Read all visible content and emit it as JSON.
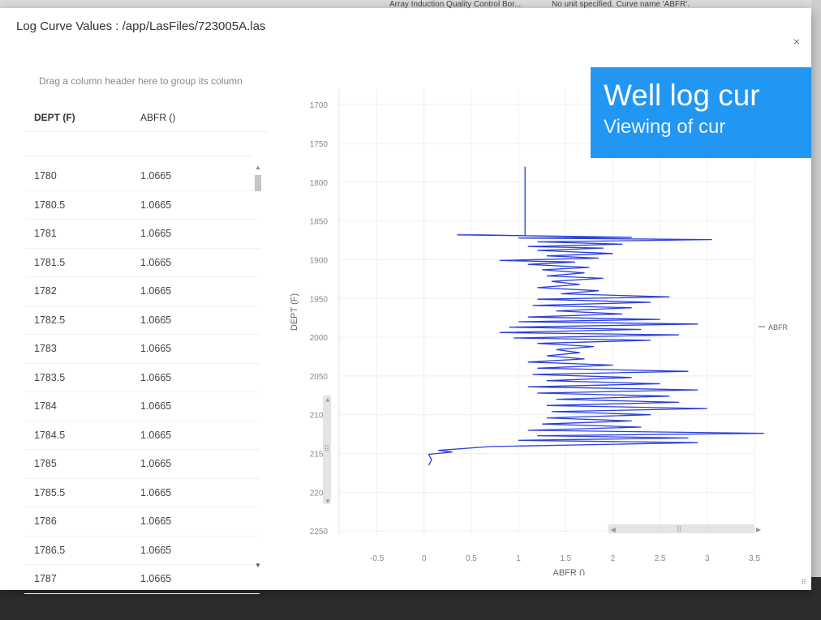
{
  "background": {
    "col_a": "Array Induction Quality Control Bor...",
    "col_b": "No unit specified. Curve name 'ABFR'."
  },
  "modal": {
    "title": "Log Curve Values : /app/LasFiles/723005A.las",
    "close": "×"
  },
  "grid": {
    "group_hint": "Drag a column header here to group its column",
    "columns": [
      "DEPT (F)",
      "ABFR ()"
    ],
    "rows": [
      [
        "1780",
        "1.0665"
      ],
      [
        "1780.5",
        "1.0665"
      ],
      [
        "1781",
        "1.0665"
      ],
      [
        "1781.5",
        "1.0665"
      ],
      [
        "1782",
        "1.0665"
      ],
      [
        "1782.5",
        "1.0665"
      ],
      [
        "1783",
        "1.0665"
      ],
      [
        "1783.5",
        "1.0665"
      ],
      [
        "1784",
        "1.0665"
      ],
      [
        "1784.5",
        "1.0665"
      ],
      [
        "1785",
        "1.0665"
      ],
      [
        "1785.5",
        "1.0665"
      ],
      [
        "1786",
        "1.0665"
      ],
      [
        "1786.5",
        "1.0665"
      ],
      [
        "1787",
        "1.0665"
      ]
    ]
  },
  "banner": {
    "title": "Well log cur",
    "subtitle": "Viewing of cur"
  },
  "chart_data": {
    "type": "line",
    "xlabel": "ABFR ()",
    "ylabel": "DEPT (F)",
    "xlim": [
      -0.9,
      3.5
    ],
    "ylim": [
      1680,
      2255
    ],
    "y_reversed": true,
    "xticks": [
      -0.5,
      0,
      0.5,
      1,
      1.5,
      2,
      2.5,
      3,
      3.5
    ],
    "yticks": [
      1700,
      1750,
      1800,
      1850,
      1900,
      1950,
      2000,
      2050,
      2100,
      2150,
      2200,
      2250
    ],
    "grid": true,
    "legend": "right",
    "series_color": "#2b3fdc",
    "series": [
      {
        "name": "ABFR",
        "points": [
          [
            1.07,
            1780
          ],
          [
            1.07,
            1869
          ],
          [
            0.6,
            1868
          ],
          [
            0.35,
            1868
          ],
          [
            1.05,
            1869
          ],
          [
            2.2,
            1871
          ],
          [
            1.0,
            1872
          ],
          [
            3.05,
            1874
          ],
          [
            1.2,
            1877
          ],
          [
            2.1,
            1880
          ],
          [
            1.1,
            1883
          ],
          [
            1.9,
            1885
          ],
          [
            1.2,
            1888
          ],
          [
            2.0,
            1892
          ],
          [
            1.3,
            1895
          ],
          [
            1.85,
            1898
          ],
          [
            0.8,
            1901
          ],
          [
            1.6,
            1903
          ],
          [
            1.1,
            1906
          ],
          [
            1.75,
            1910
          ],
          [
            1.25,
            1913
          ],
          [
            1.7,
            1917
          ],
          [
            1.3,
            1921
          ],
          [
            1.9,
            1924
          ],
          [
            1.35,
            1928
          ],
          [
            1.65,
            1932
          ],
          [
            1.2,
            1936
          ],
          [
            1.85,
            1940
          ],
          [
            1.45,
            1944
          ],
          [
            2.6,
            1948
          ],
          [
            1.2,
            1951
          ],
          [
            2.4,
            1955
          ],
          [
            1.15,
            1959
          ],
          [
            2.2,
            1962
          ],
          [
            1.4,
            1966
          ],
          [
            2.1,
            1970
          ],
          [
            1.1,
            1974
          ],
          [
            2.5,
            1977
          ],
          [
            1.0,
            1980
          ],
          [
            2.9,
            1983
          ],
          [
            0.9,
            1987
          ],
          [
            2.3,
            1990
          ],
          [
            0.8,
            1994
          ],
          [
            2.7,
            1997
          ],
          [
            0.95,
            2001
          ],
          [
            2.4,
            2004
          ],
          [
            1.2,
            2008
          ],
          [
            1.8,
            2012
          ],
          [
            1.4,
            2016
          ],
          [
            1.65,
            2020
          ],
          [
            1.3,
            2024
          ],
          [
            1.7,
            2028
          ],
          [
            1.1,
            2032
          ],
          [
            2.0,
            2036
          ],
          [
            1.2,
            2040
          ],
          [
            2.8,
            2044
          ],
          [
            1.15,
            2048
          ],
          [
            2.2,
            2052
          ],
          [
            1.3,
            2056
          ],
          [
            2.5,
            2060
          ],
          [
            1.1,
            2064
          ],
          [
            2.9,
            2068
          ],
          [
            1.2,
            2072
          ],
          [
            2.6,
            2076
          ],
          [
            1.4,
            2080
          ],
          [
            2.7,
            2084
          ],
          [
            1.3,
            2088
          ],
          [
            3.0,
            2092
          ],
          [
            1.35,
            2096
          ],
          [
            2.4,
            2100
          ],
          [
            1.3,
            2104
          ],
          [
            2.2,
            2108
          ],
          [
            1.25,
            2112
          ],
          [
            2.3,
            2116
          ],
          [
            1.1,
            2120
          ],
          [
            3.6,
            2124
          ],
          [
            1.2,
            2127
          ],
          [
            2.8,
            2130
          ],
          [
            1.0,
            2133
          ],
          [
            2.9,
            2136
          ],
          [
            0.7,
            2141
          ],
          [
            0.15,
            2146
          ],
          [
            0.3,
            2148
          ],
          [
            0.05,
            2151
          ],
          [
            0.08,
            2158
          ],
          [
            0.05,
            2165
          ]
        ]
      }
    ]
  }
}
